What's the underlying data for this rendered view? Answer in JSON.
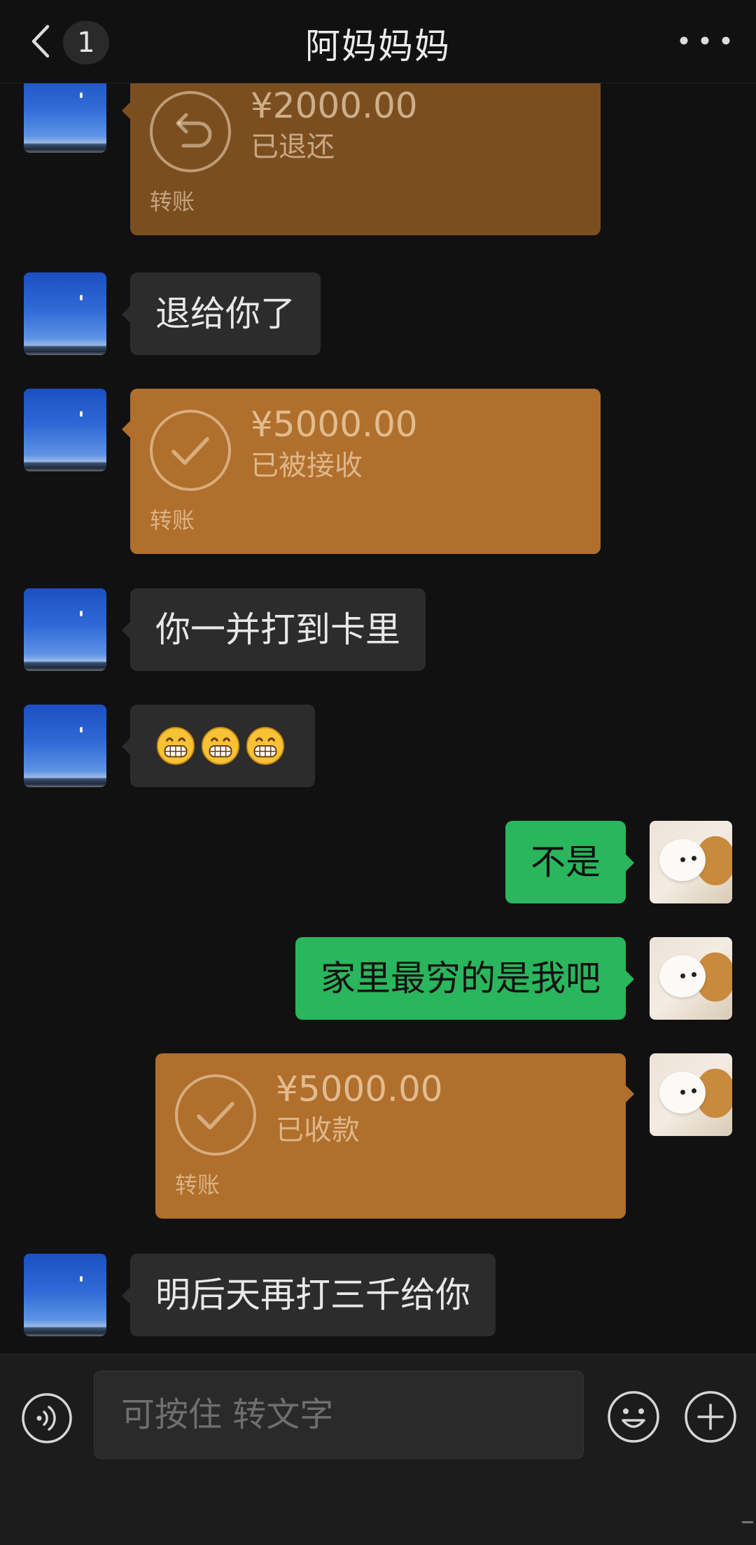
{
  "header": {
    "unread_count": "1",
    "title": "阿妈妈妈",
    "back_icon": "chevron-left-icon",
    "more_icon": "more-horizontal-icon"
  },
  "messages": [
    {
      "side": "received",
      "type": "transfer",
      "amount": "¥2000.00",
      "status": "已退还",
      "label": "转账",
      "icon": "return-arrow-icon",
      "color": "#7b4e20"
    },
    {
      "side": "received",
      "type": "text",
      "text": "退给你了"
    },
    {
      "side": "received",
      "type": "transfer",
      "amount": "¥5000.00",
      "status": "已被接收",
      "label": "转账",
      "icon": "check-circle-icon",
      "color": "#b06f2c"
    },
    {
      "side": "received",
      "type": "text",
      "text": "你一并打到卡里"
    },
    {
      "side": "received",
      "type": "emoji",
      "emojis": [
        "grinning-face-emoji",
        "grinning-face-emoji",
        "grinning-face-emoji"
      ]
    },
    {
      "side": "sent",
      "type": "text",
      "text": "不是"
    },
    {
      "side": "sent",
      "type": "text",
      "text": "家里最穷的是我吧"
    },
    {
      "side": "sent",
      "type": "transfer",
      "amount": "¥5000.00",
      "status": "已收款",
      "label": "转账",
      "icon": "check-circle-icon",
      "color": "#b06f2c"
    },
    {
      "side": "received",
      "type": "text",
      "text": "明后天再打三千给你"
    }
  ],
  "input": {
    "placeholder": "可按住 转文字",
    "voice_icon": "voice-icon",
    "emoji_icon": "emoji-icon",
    "plus_icon": "plus-icon"
  },
  "colors": {
    "background": "#111111",
    "received_bubble": "#2c2c2c",
    "sent_bubble": "#2ab65c",
    "transfer_returned": "#7b4e20",
    "transfer_received": "#b06f2c"
  }
}
